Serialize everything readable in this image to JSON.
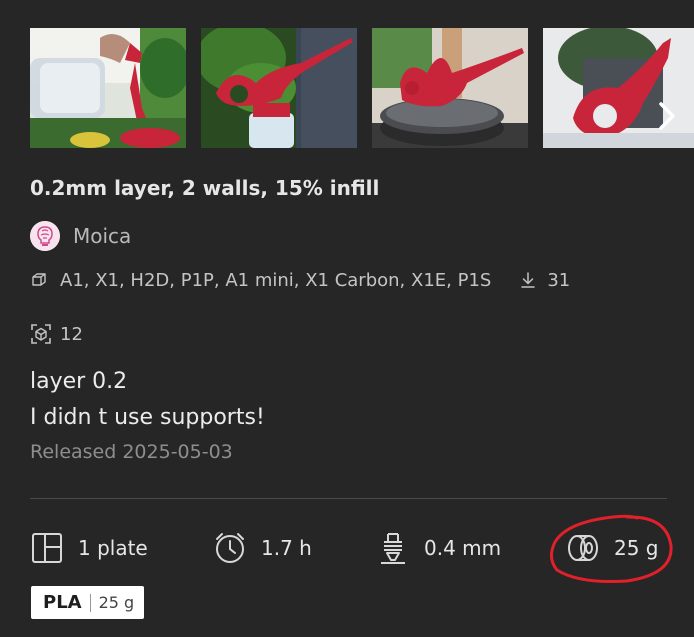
{
  "gallery": {
    "images": [
      {
        "name": "watering-spout-bottle-photo"
      },
      {
        "name": "spout-on-bottle-plants-photo"
      },
      {
        "name": "spout-on-stand-photo"
      },
      {
        "name": "spout-closeup-photo"
      }
    ],
    "next_icon": "chevron-right-icon"
  },
  "title": "0.2mm layer, 2 walls, 15% infill",
  "author": {
    "name": "Moica",
    "avatar_icon": "lightbulb-brain-avatar"
  },
  "printers": {
    "icon": "printer-cube-icon",
    "list": "A1, X1, H2D, P1P, A1 mini, X1 Carbon, X1E, P1S"
  },
  "downloads": {
    "icon": "download-icon",
    "count": "31"
  },
  "boosts": {
    "icon": "scan-cube-icon",
    "count": "12"
  },
  "description": {
    "line1": "layer 0.2",
    "line2": "I didn t use supports!"
  },
  "released": "Released 2025-05-03",
  "stats": {
    "plates": {
      "icon": "plate-layout-icon",
      "label": "1 plate"
    },
    "time": {
      "icon": "clock-icon",
      "label": "1.7 h"
    },
    "nozzle": {
      "icon": "nozzle-icon",
      "label": "0.4 mm"
    },
    "weight": {
      "icon": "filament-spool-icon",
      "label": "25 g"
    }
  },
  "filament_tag": {
    "material": "PLA",
    "weight": "25 g"
  },
  "colors": {
    "background": "#262626",
    "spout_red": "#c8253a",
    "annotation_red": "#e0202a"
  }
}
